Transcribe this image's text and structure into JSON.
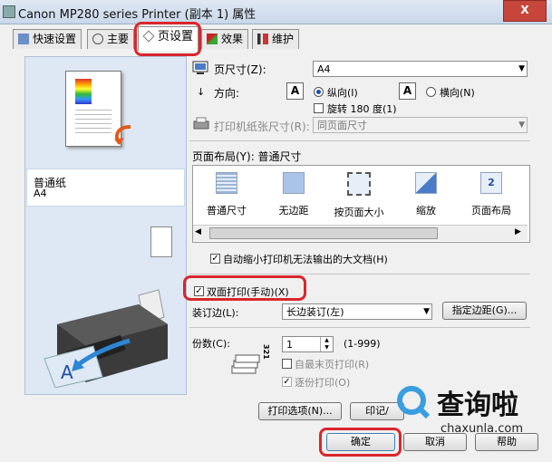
{
  "window": {
    "title": "Canon MP280 series Printer (副本 1) 属性",
    "close_label": "X"
  },
  "tabs": [
    {
      "label": "快速设置"
    },
    {
      "label": "主要"
    },
    {
      "label": "页设置"
    },
    {
      "label": "效果"
    },
    {
      "label": "维护"
    }
  ],
  "left": {
    "media_type": "普通纸",
    "media_size": "A4"
  },
  "page_size": {
    "label": "页尺寸(Z):",
    "value": "A4"
  },
  "orientation": {
    "label": "方向:",
    "portrait": "纵向(I)",
    "landscape": "横向(N)",
    "rotate": "旋转 180 度(1)",
    "glyph": "A"
  },
  "printer_paper": {
    "label": "打印机纸张尺寸(R):",
    "value": "同页面尺寸"
  },
  "page_layout": {
    "label": "页面布局(Y): 普通尺寸",
    "options": [
      "普通尺寸",
      "无边距",
      "按页面大小",
      "缩放",
      "页面布局"
    ],
    "icon_text": "2"
  },
  "auto_reduce": {
    "label": "自动缩小打印机无法输出的大文档(H)"
  },
  "duplex": {
    "label": "双面打印(手动)(X)"
  },
  "binding": {
    "label": "装订边(L):",
    "value": "长边装订(左)",
    "margin_button": "指定边距(G)..."
  },
  "copies": {
    "label": "份数(C):",
    "value": "1",
    "range": "(1-999)",
    "last_page_first": "自最末页打印(R)",
    "collate": "逐份打印(O)",
    "stack_digits": "321"
  },
  "buttons": {
    "print_options": "打印选项(N)...",
    "stamp": "印记/",
    "ok": "确定",
    "cancel": "取消",
    "help": "帮助"
  },
  "watermark": {
    "name": "查询啦",
    "url": "chaxunla.com"
  },
  "colors": {
    "highlight": "#d9262c",
    "accent": "#1e4fa8",
    "watermark": "#3a9de0"
  }
}
